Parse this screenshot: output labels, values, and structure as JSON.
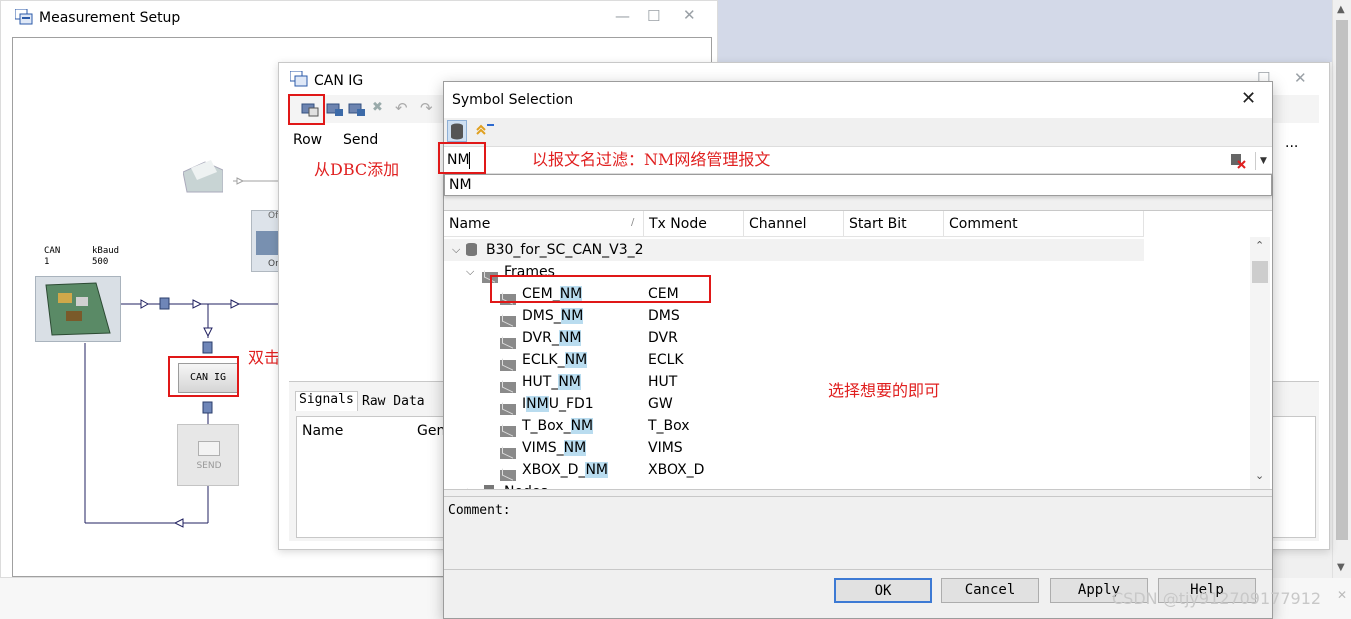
{
  "measurement": {
    "title": "Measurement Setup",
    "can_label": "CAN\n1",
    "kbaud_label": "kBaud\n500",
    "can_ig_block": "CAN IG",
    "send_block": "SEND",
    "online_label_top": "Of",
    "online_label_bottom": "On"
  },
  "can_ig": {
    "title": "CAN IG",
    "col_row": "Row",
    "col_send": "Send",
    "tab_signals": "Signals",
    "tab_raw": "Raw Data",
    "col_name": "Name",
    "col_gen": "Gen",
    "more": "..."
  },
  "symbol": {
    "title": "Symbol Selection",
    "filter_value": "NM",
    "dropdown_item": "NM",
    "columns": [
      "Name",
      "Tx Node",
      "Channel Mask",
      "Start Bit",
      "Comment"
    ],
    "database": "B30_for_SC_CAN_V3_2",
    "frames_label": "Frames",
    "nodes_label": "Nodes",
    "rows": [
      {
        "pre": "CEM_",
        "hit": "NM",
        "post": "",
        "node": "CEM"
      },
      {
        "pre": "DMS_",
        "hit": "NM",
        "post": "",
        "node": "DMS"
      },
      {
        "pre": "DVR_",
        "hit": "NM",
        "post": "",
        "node": "DVR"
      },
      {
        "pre": "ECLK_",
        "hit": "NM",
        "post": "",
        "node": "ECLK"
      },
      {
        "pre": "HUT_",
        "hit": "NM",
        "post": "",
        "node": "HUT"
      },
      {
        "pre": "I",
        "hit": "NM",
        "post": "U_FD1",
        "node": "GW"
      },
      {
        "pre": "T_Box_",
        "hit": "NM",
        "post": "",
        "node": "T_Box"
      },
      {
        "pre": "VIMS_",
        "hit": "NM",
        "post": "",
        "node": "VIMS"
      },
      {
        "pre": "XBOX_D_",
        "hit": "NM",
        "post": "",
        "node": "XBOX_D"
      }
    ],
    "comment_label": "Comment:",
    "buttons": {
      "ok": "OK",
      "cancel": "Cancel",
      "apply": "Apply",
      "help": "Help"
    }
  },
  "annotations": {
    "add_from_dbc": "从DBC添加",
    "filter_by_name": "以报文名过滤：NM网络管理报文",
    "double_click": "双击",
    "select_wanted": "选择想要的即可"
  },
  "watermark": "CSDN @tjy912709177912",
  "colors": {
    "annotation_red": "#e02020",
    "highlight": "#b9dcef",
    "desktop_blue": "#d3d9e8"
  }
}
